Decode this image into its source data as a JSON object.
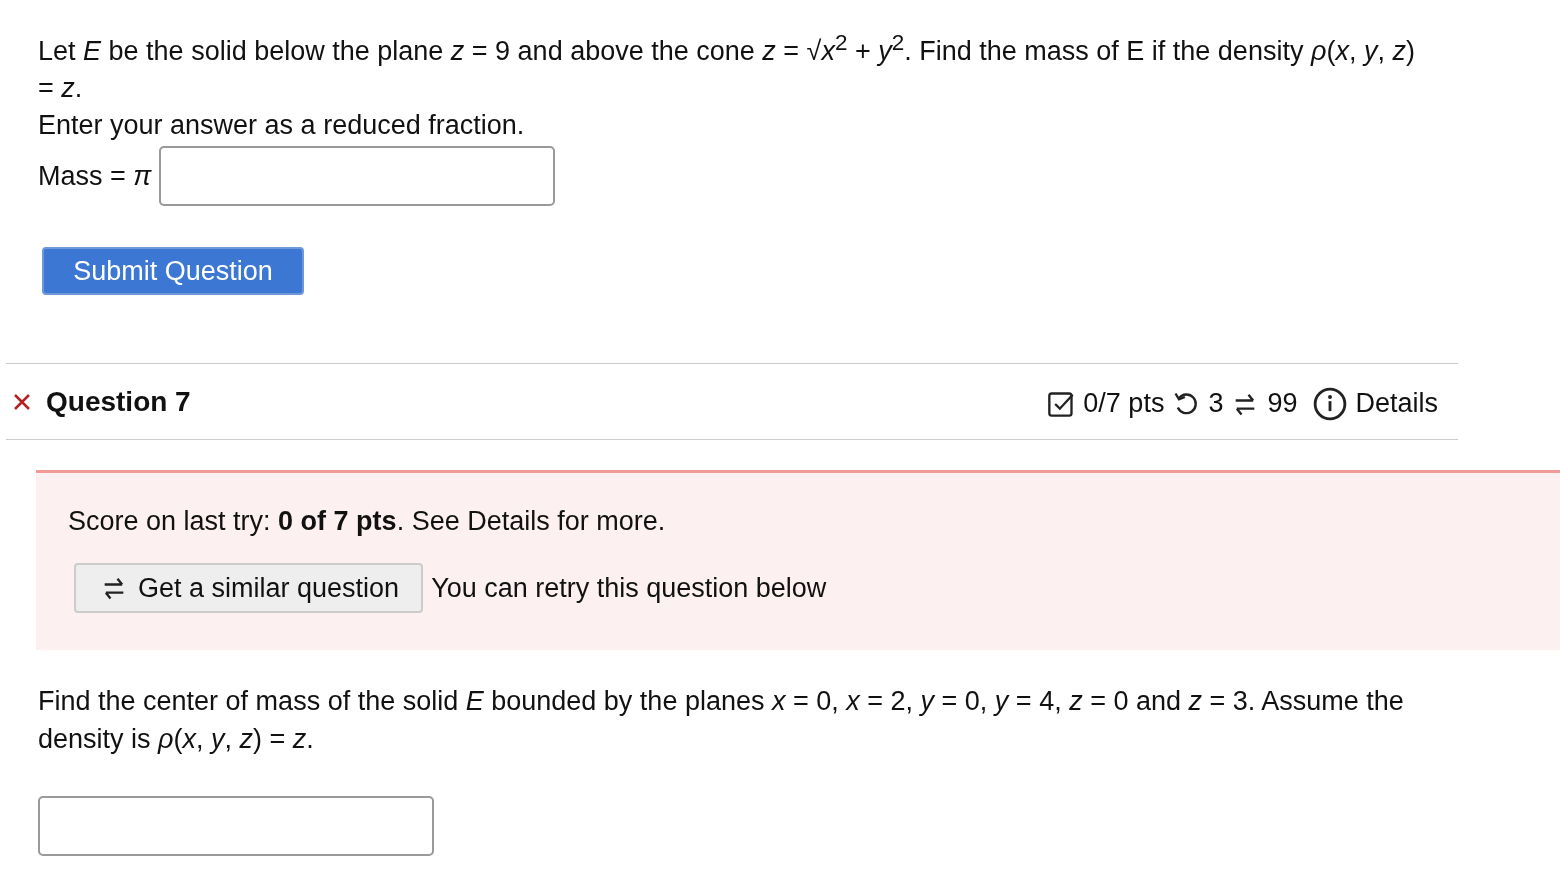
{
  "previous_question": {
    "text": "Let *E* be the solid below the plane *z* = 9 and above the cone *z* = √*x*$^{2}$ + *y*$^{2}$. Find the mass of E if the density *ρ*(*x*, *y*, *z*) = *z*.",
    "instruction": "Enter your answer as a reduced fraction.",
    "answer_label": "Mass = *π*",
    "submit_button": "Submit Question"
  },
  "question": {
    "correct": false,
    "title": "Question 7",
    "score": "0/7 pts",
    "tries_left": "3",
    "versions": "99",
    "details": "Details"
  },
  "feedback": {
    "score_text": "Score on last try: **0 of 7 pts**. See Details for more.",
    "similar_button": "Get a similar question",
    "retry_note": "You can retry this question below"
  },
  "prompt": "Find the center of mass of the solid *E* bounded by the planes *x* = 0, *x* = 2, *y* = 0, *y* = 4, *z* = 0 and *z* = 3. Assume the density is *ρ*(*x*, *y*, *z*) = *z*."
}
